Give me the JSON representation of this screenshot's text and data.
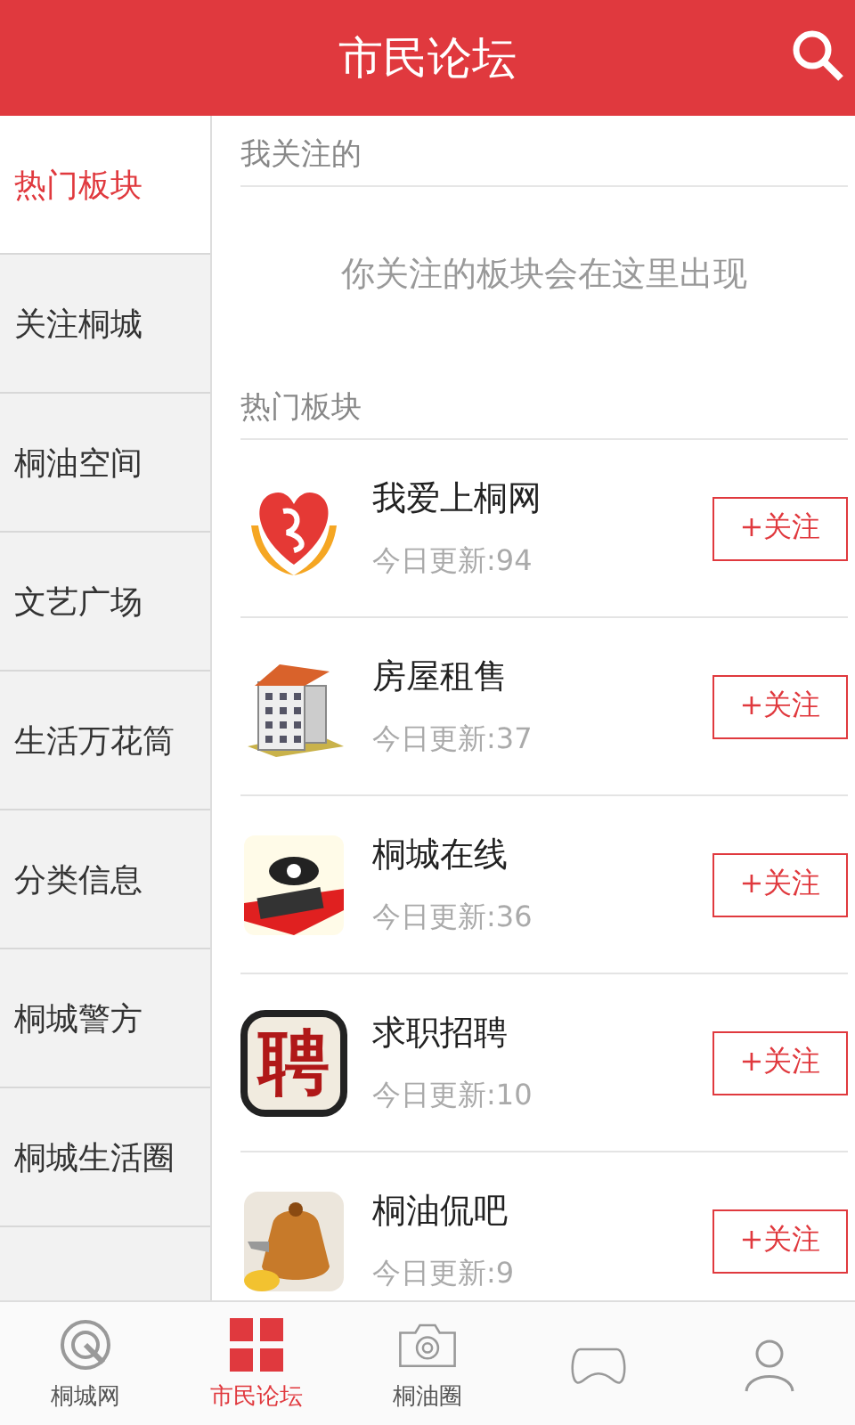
{
  "header": {
    "title": "市民论坛"
  },
  "sidebar": {
    "items": [
      {
        "label": "热门板块",
        "selected": true
      },
      {
        "label": "关注桐城",
        "selected": false
      },
      {
        "label": "桐油空间",
        "selected": false
      },
      {
        "label": "文艺广场",
        "selected": false
      },
      {
        "label": "生活万花筒",
        "selected": false
      },
      {
        "label": "分类信息",
        "selected": false
      },
      {
        "label": "桐城警方",
        "selected": false
      },
      {
        "label": "桐城生活圈",
        "selected": false
      }
    ]
  },
  "followed": {
    "heading": "我关注的",
    "empty_message": "你关注的板块会在这里出现"
  },
  "hot": {
    "heading": "热门板块",
    "boards": [
      {
        "kind": "heart",
        "name": "我爱上桐网",
        "updates": "今日更新:94",
        "button": "+关注"
      },
      {
        "kind": "building",
        "name": "房屋租售",
        "updates": "今日更新:37",
        "button": "+关注"
      },
      {
        "kind": "eye",
        "name": "桐城在线",
        "updates": "今日更新:36",
        "button": "+关注"
      },
      {
        "kind": "character",
        "glyph": "聘",
        "name": "求职招聘",
        "updates": "今日更新:10",
        "button": "+关注"
      },
      {
        "kind": "pot",
        "name": "桐油侃吧",
        "updates": "今日更新:9",
        "button": "+关注"
      }
    ]
  },
  "tabbar": {
    "tabs": [
      {
        "kind": "target",
        "label": "桐城网",
        "selected": false
      },
      {
        "kind": "grid",
        "label": "市民论坛",
        "selected": true
      },
      {
        "kind": "camera",
        "label": "桐油圈",
        "selected": false
      },
      {
        "kind": "gamepad",
        "selected": false
      },
      {
        "kind": "person",
        "selected": false
      }
    ]
  }
}
